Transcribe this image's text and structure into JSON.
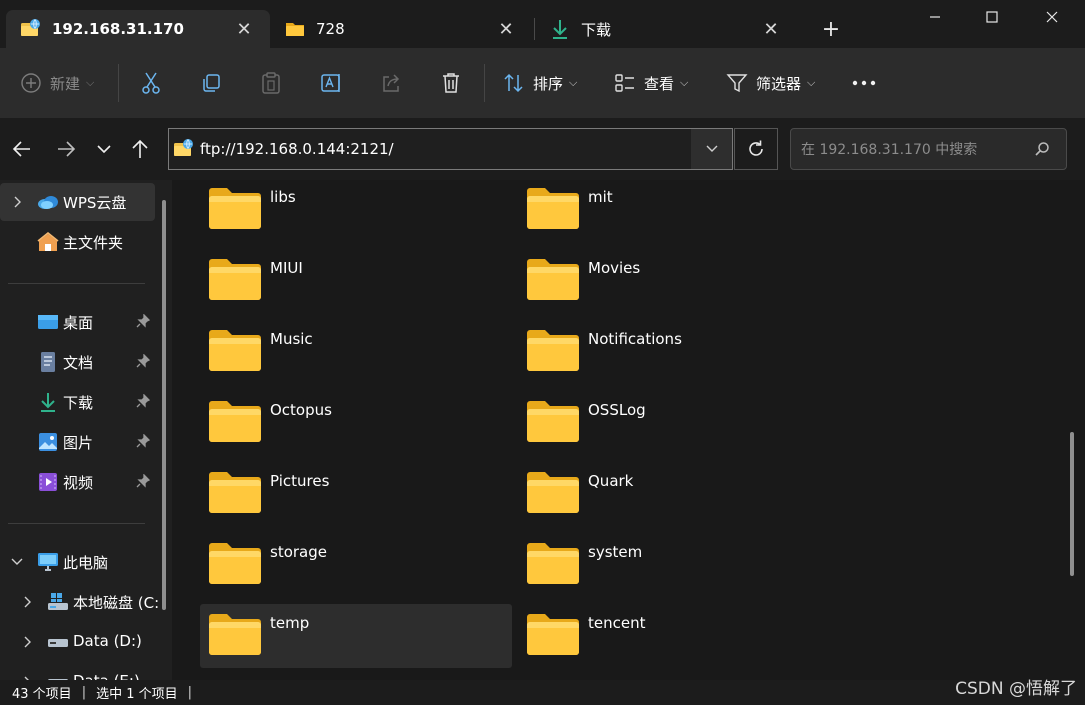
{
  "tabs": [
    {
      "title": "192.168.31.170",
      "icon": "ftp-network-folder-icon",
      "active": true
    },
    {
      "title": "728",
      "icon": "folder-icon",
      "active": false
    },
    {
      "title": "下载",
      "icon": "download-arrow-icon",
      "active": false
    }
  ],
  "toolbar": {
    "new_label": "新建",
    "sort_label": "排序",
    "view_label": "查看",
    "filter_label": "筛选器",
    "icons": [
      "cut-icon",
      "copy-icon",
      "paste-icon",
      "rename-icon",
      "share-icon",
      "delete-icon",
      "more-icon"
    ]
  },
  "address": {
    "path": "ftp://192.168.0.144:2121/",
    "search_placeholder": "在 192.168.31.170 中搜索"
  },
  "sidebar": {
    "cloud": "WPS云盘",
    "home": "主文件夹",
    "quick": [
      {
        "label": "桌面",
        "icon": "desktop-icon"
      },
      {
        "label": "文档",
        "icon": "document-icon"
      },
      {
        "label": "下载",
        "icon": "download-icon"
      },
      {
        "label": "图片",
        "icon": "pictures-icon"
      },
      {
        "label": "视频",
        "icon": "videos-icon"
      }
    ],
    "this_pc": "此电脑",
    "drives": [
      "本地磁盘 (C:",
      "Data (D:)",
      "Data (E:)"
    ]
  },
  "files": [
    [
      "libs",
      "mit"
    ],
    [
      "MIUI",
      "Movies"
    ],
    [
      "Music",
      "Notifications"
    ],
    [
      "Octopus",
      "OSSLog"
    ],
    [
      "Pictures",
      "Quark"
    ],
    [
      "storage",
      "system"
    ],
    [
      "temp",
      "tencent"
    ]
  ],
  "status": {
    "count": "43 个项目",
    "selected": "选中 1 个项目"
  },
  "watermark": "CSDN @悟解了",
  "colors": {
    "accent_blue": "#4aa8e8",
    "folder_yellow": "#ffc83d",
    "download_green": "#2fb38c"
  }
}
